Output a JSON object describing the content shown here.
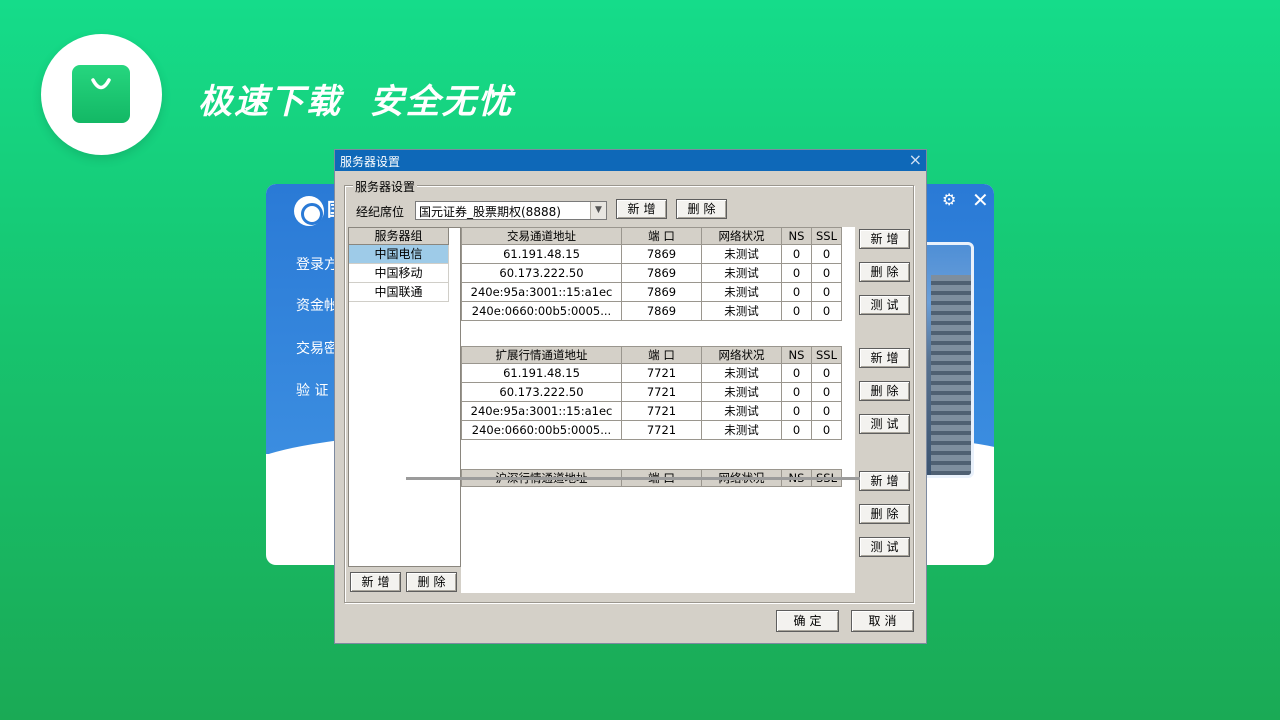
{
  "banner": {
    "slogan": "极速下载  安全无忧"
  },
  "background_window": {
    "logo_letter": "国",
    "menu": [
      "登录方",
      "资金帐",
      "交易密",
      "验 证"
    ]
  },
  "dialog": {
    "title": "服务器设置",
    "close": "×",
    "group_title": "服务器设置",
    "broker_label": "经纪席位",
    "broker_value": "国元证券_股票期权(8888)",
    "add_label": "新增",
    "delete_label": "删除",
    "test_label": "测试",
    "ok_label": "确定",
    "cancel_label": "取消",
    "server_groups": {
      "header": "服务器组",
      "items": [
        "中国电信",
        "中国移动",
        "中国联通"
      ],
      "selected": "中国电信"
    },
    "tables": [
      {
        "headers": [
          "交易通道地址",
          "端 口",
          "网络状况",
          "NS",
          "SSL"
        ],
        "rows": [
          [
            "61.191.48.15",
            "7869",
            "未测试",
            "0",
            "0"
          ],
          [
            "60.173.222.50",
            "7869",
            "未测试",
            "0",
            "0"
          ],
          [
            "240e:95a:3001::15:a1ec",
            "7869",
            "未测试",
            "0",
            "0"
          ],
          [
            "240e:0660:00b5:0005...",
            "7869",
            "未测试",
            "0",
            "0"
          ]
        ]
      },
      {
        "headers": [
          "扩展行情通道地址",
          "端 口",
          "网络状况",
          "NS",
          "SSL"
        ],
        "rows": [
          [
            "61.191.48.15",
            "7721",
            "未测试",
            "0",
            "0"
          ],
          [
            "60.173.222.50",
            "7721",
            "未测试",
            "0",
            "0"
          ],
          [
            "240e:95a:3001::15:a1ec",
            "7721",
            "未测试",
            "0",
            "0"
          ],
          [
            "240e:0660:00b5:0005...",
            "7721",
            "未测试",
            "0",
            "0"
          ]
        ]
      },
      {
        "headers": [
          "沪深行情通道地址",
          "端 口",
          "网络状况",
          "NS",
          "SSL"
        ],
        "rows": []
      }
    ]
  }
}
